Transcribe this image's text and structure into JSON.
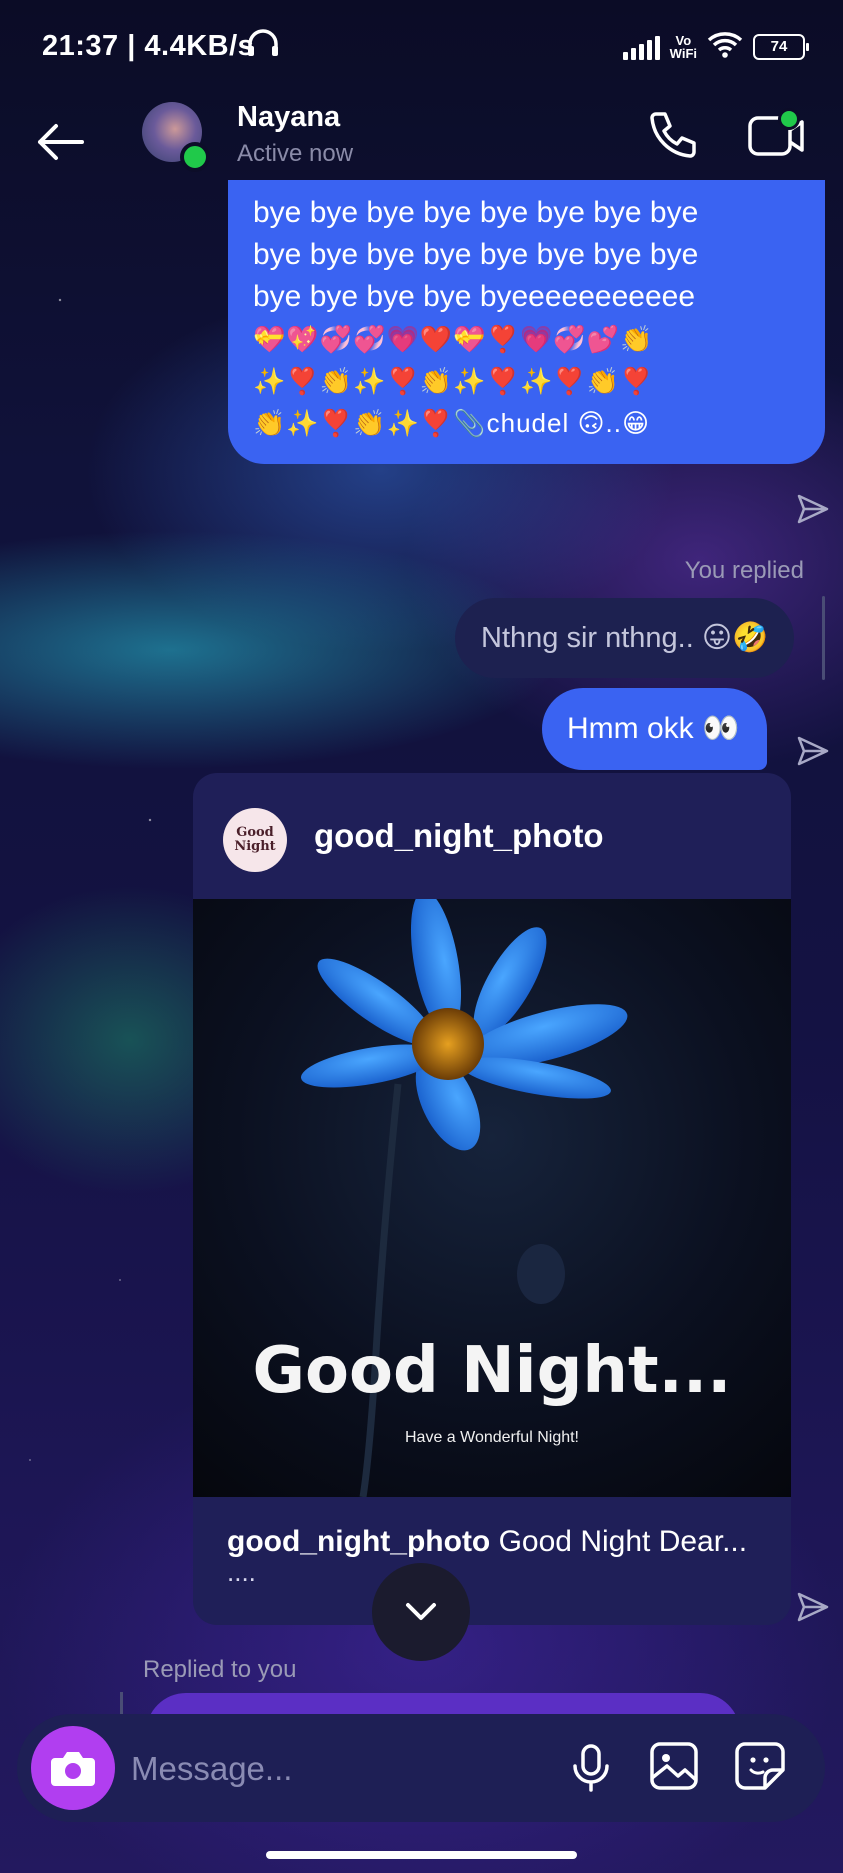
{
  "status_bar": {
    "time_speed": "21:37 | 4.4KB/s",
    "network_top": "Vo",
    "network_bottom": "WiFi",
    "battery": "74"
  },
  "header": {
    "name": "Nayana",
    "status": "Active now"
  },
  "messages": {
    "m1_lines": [
      "bye bye bye bye bye bye bye bye",
      "bye bye bye bye bye bye bye bye",
      "bye bye bye bye byeeeeeeeeeee"
    ],
    "m1_emoji_1": "💝💖💞💞💗❤️💝❣️💗💞💕👏",
    "m1_emoji_2": "✨❣️👏✨❣️👏✨❣️✨❣️👏❣️",
    "m1_emoji_3": "👏✨❣️👏✨❣️📎chudel 🙃..😁",
    "replied_label": "You replied",
    "m2": "Nthng sir nthng.. 😛🤣",
    "m3": "Hmm okk 👀"
  },
  "post": {
    "logo_line1": "Good",
    "logo_line2": "Night",
    "username": "good_night_photo",
    "image_title": "Good Night...",
    "image_subtitle": "Have a Wonderful Night!",
    "caption_user": "good_night_photo",
    "caption_text": " Good Night Dear...",
    "caption_more": "...."
  },
  "reply": {
    "label": "Replied to you"
  },
  "composer": {
    "placeholder": "Message..."
  },
  "colors": {
    "sent_bubble": "#3a63f2",
    "received_bubble": "#1d2150",
    "online_dot": "#20c94a",
    "camera_button": "#b13ef0"
  }
}
